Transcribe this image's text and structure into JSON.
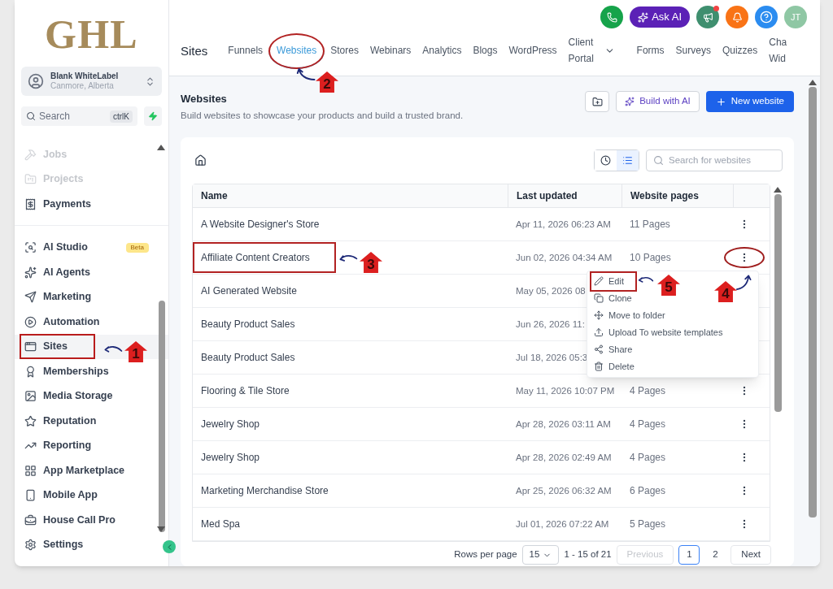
{
  "logo": "GHL",
  "account": {
    "name": "Blank WhiteLabel",
    "location": "Canmore, Alberta"
  },
  "sidebar_search": {
    "placeholder": "Search",
    "shortcut": "ctrlK"
  },
  "sidebar": {
    "groups": [
      {
        "items": [
          {
            "label": "Jobs",
            "faded": true,
            "selected": false,
            "outlined": false
          },
          {
            "label": "Projects",
            "faded": true,
            "selected": false,
            "outlined": false
          },
          {
            "label": "Payments",
            "faded": false,
            "selected": false,
            "outlined": false
          }
        ]
      },
      {
        "items": [
          {
            "label": "AI Studio",
            "badge": "Beta",
            "faded": false,
            "selected": false,
            "outlined": false
          },
          {
            "label": "AI Agents",
            "faded": false,
            "selected": false,
            "outlined": false
          },
          {
            "label": "Marketing",
            "faded": false,
            "selected": false,
            "outlined": false
          },
          {
            "label": "Automation",
            "faded": false,
            "selected": false,
            "outlined": false
          },
          {
            "label": "Sites",
            "faded": false,
            "selected": true,
            "outlined": true
          },
          {
            "label": "Memberships",
            "faded": false,
            "selected": false,
            "outlined": false
          },
          {
            "label": "Media Storage",
            "faded": false,
            "selected": false,
            "outlined": false
          },
          {
            "label": "Reputation",
            "faded": false,
            "selected": false,
            "outlined": false
          },
          {
            "label": "Reporting",
            "faded": false,
            "selected": false,
            "outlined": false
          },
          {
            "label": "App Marketplace",
            "faded": false,
            "selected": false,
            "outlined": false
          },
          {
            "label": "Mobile App",
            "faded": false,
            "selected": false,
            "outlined": false
          },
          {
            "label": "House Call Pro",
            "faded": false,
            "selected": false,
            "outlined": false
          },
          {
            "label": "Settings",
            "faded": false,
            "selected": false,
            "outlined": false
          }
        ]
      }
    ]
  },
  "top_actions": {
    "ask_ai": "Ask AI",
    "megaphone_alert": true,
    "avatar": "JT"
  },
  "header": {
    "section": "Sites",
    "tabs": [
      {
        "label": "Funnels",
        "selected": false,
        "circled": false
      },
      {
        "label": "Websites",
        "selected": true,
        "circled": true
      },
      {
        "label": "Stores",
        "selected": false,
        "circled": false
      },
      {
        "label": "Webinars",
        "selected": false,
        "circled": false
      },
      {
        "label": "Analytics",
        "selected": false,
        "circled": false
      },
      {
        "label": "Blogs",
        "selected": false,
        "circled": false
      },
      {
        "label": "WordPress",
        "selected": false,
        "circled": false
      },
      {
        "label": "Client Portal",
        "selected": false,
        "circled": false,
        "dropdown": true
      },
      {
        "label": "Forms",
        "selected": false,
        "circled": false
      },
      {
        "label": "Surveys",
        "selected": false,
        "circled": false
      },
      {
        "label": "Quizzes",
        "selected": false,
        "circled": false
      },
      {
        "label": "Cha Wid",
        "selected": false,
        "circled": false
      }
    ]
  },
  "page": {
    "title": "Websites",
    "subtitle": "Build websites to showcase your products and build a trusted brand.",
    "build_button": "Build with AI",
    "new_button": "New website"
  },
  "toolbar": {
    "views": [
      {
        "kind": "recent",
        "selected": false
      },
      {
        "kind": "list",
        "selected": true
      }
    ],
    "search_placeholder": "Search for websites"
  },
  "table": {
    "columns": [
      "Name",
      "Last updated",
      "Website pages"
    ],
    "rows": [
      {
        "name": "A Website Designer's Store",
        "updated": "Apr 11, 2026 06:23 AM",
        "pages": "11 Pages",
        "actions": true,
        "outlined": false,
        "circled": false
      },
      {
        "name": "Affiliate Content Creators",
        "updated": "Jun 02, 2026 04:34 AM",
        "pages": "10 Pages",
        "actions": true,
        "outlined": true,
        "circled": true
      },
      {
        "name": "AI Generated Website",
        "updated": "May 05, 2026 08",
        "outlined": false
      },
      {
        "name": "Beauty Product Sales",
        "updated": "Jun 26, 2026 11:",
        "outlined": false
      },
      {
        "name": "Beauty Product Sales",
        "updated": "Jul 18, 2026 05:3",
        "outlined": false
      },
      {
        "name": "Flooring & Tile Store",
        "updated": "May 11, 2026 10:07 PM",
        "pages": "4 Pages",
        "actions": true,
        "outlined": false,
        "circled": false
      },
      {
        "name": "Jewelry Shop",
        "updated": "Apr 28, 2026 03:11 AM",
        "pages": "4 Pages",
        "actions": true,
        "outlined": false,
        "circled": false
      },
      {
        "name": "Jewelry Shop",
        "updated": "Apr 28, 2026 02:49 AM",
        "pages": "4 Pages",
        "actions": true,
        "outlined": false,
        "circled": false
      },
      {
        "name": "Marketing Merchandise Store",
        "updated": "Apr 25, 2026 06:32 AM",
        "pages": "6 Pages",
        "actions": true,
        "outlined": false,
        "circled": false
      },
      {
        "name": "Med Spa",
        "updated": "Jul 01, 2026 07:22 AM",
        "pages": "5 Pages",
        "actions": true,
        "outlined": false,
        "circled": false
      }
    ]
  },
  "row_menu": {
    "items": [
      {
        "kind": "edit",
        "label": "Edit",
        "outlined": true
      },
      {
        "kind": "clone",
        "label": "Clone",
        "outlined": false
      },
      {
        "kind": "move",
        "label": "Move to folder",
        "outlined": false
      },
      {
        "kind": "upload",
        "label": "Upload To website templates",
        "outlined": false
      },
      {
        "kind": "share",
        "label": "Share",
        "outlined": false
      },
      {
        "kind": "delete",
        "label": "Delete",
        "outlined": false
      }
    ]
  },
  "pagination": {
    "label": "Rows per page",
    "per_page": "15",
    "range": "1 - 15 of 21",
    "previous": {
      "label": "Previous",
      "disabled": true
    },
    "pages": [
      {
        "label": "1",
        "selected": true
      },
      {
        "label": "2",
        "selected": false
      }
    ],
    "next": "Next"
  },
  "annotations": [
    {
      "number": "1"
    },
    {
      "number": "2"
    },
    {
      "number": "3"
    },
    {
      "number": "4"
    },
    {
      "number": "5"
    }
  ]
}
